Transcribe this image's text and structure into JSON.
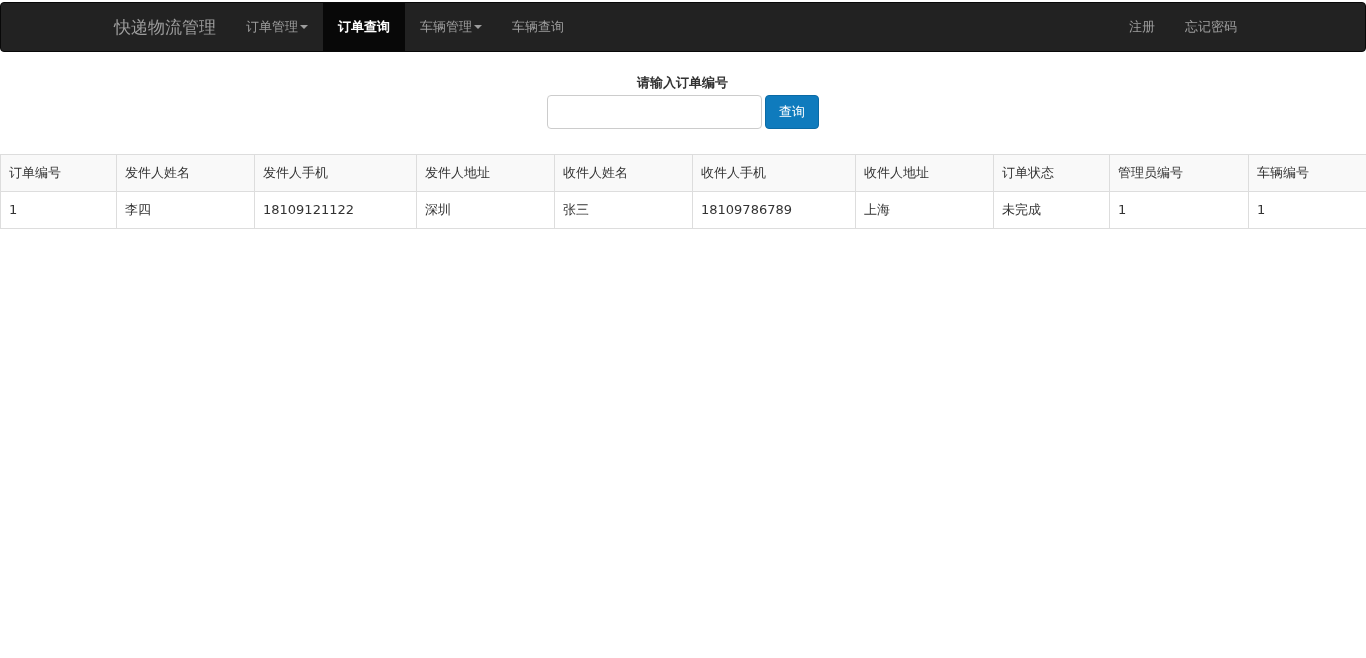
{
  "navbar": {
    "brand": "快递物流管理",
    "items": [
      {
        "label": "订单管理",
        "dropdown": true,
        "selected": false
      },
      {
        "label": "订单查询",
        "dropdown": false,
        "selected": true
      },
      {
        "label": "车辆管理",
        "dropdown": true,
        "selected": false
      },
      {
        "label": "车辆查询",
        "dropdown": false,
        "selected": false
      }
    ],
    "right_items": [
      "注册",
      "忘记密码"
    ]
  },
  "search": {
    "label": "请输入订单编号",
    "button": "查询"
  },
  "table": {
    "columns": [
      "订单编号",
      "发件人姓名",
      "发件人手机",
      "发件人地址",
      "收件人姓名",
      "收件人手机",
      "收件人地址",
      "订单状态",
      "管理员编号",
      "车辆编号"
    ],
    "rows": [
      [
        "1",
        "李四",
        "18109121122",
        "深圳",
        "张三",
        "18109786789",
        "上海",
        "未完成",
        "1",
        "1"
      ]
    ]
  }
}
